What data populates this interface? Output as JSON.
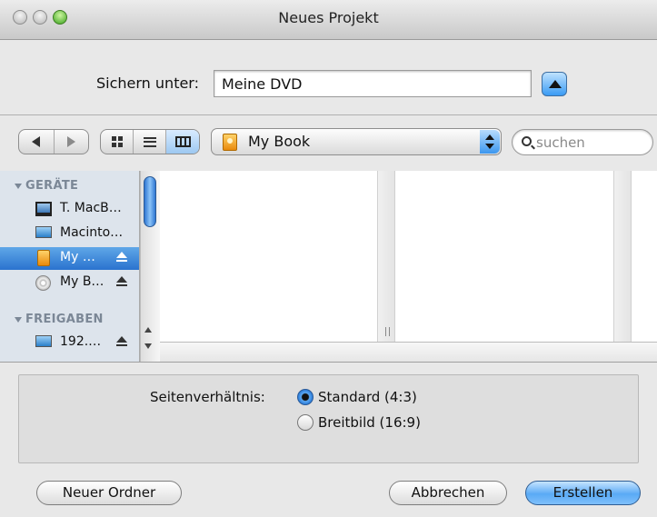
{
  "window": {
    "title": "Neues Projekt"
  },
  "save_as": {
    "label": "Sichern unter:",
    "value": "Meine DVD"
  },
  "toolbar": {
    "location": "My Book",
    "search_placeholder": "suchen"
  },
  "sidebar": {
    "sections": [
      {
        "header": "GERÄTE",
        "items": [
          {
            "label": "T. MacB…",
            "icon": "laptop-icon",
            "eject": false,
            "selected": false
          },
          {
            "label": "Macinto…",
            "icon": "hard-drive-icon",
            "eject": false,
            "selected": false
          },
          {
            "label": "My …",
            "icon": "external-drive-icon",
            "eject": true,
            "selected": true
          },
          {
            "label": "My B…",
            "icon": "disc-icon",
            "eject": true,
            "selected": false
          }
        ]
      },
      {
        "header": "FREIGABEN",
        "items": [
          {
            "label": "192.…",
            "icon": "network-computer-icon",
            "eject": true,
            "selected": false
          }
        ]
      }
    ]
  },
  "options": {
    "label": "Seitenverhältnis:",
    "choices": [
      {
        "label": "Standard (4:3)",
        "selected": true
      },
      {
        "label": "Breitbild (16:9)",
        "selected": false
      }
    ]
  },
  "buttons": {
    "new_folder": "Neuer Ordner",
    "cancel": "Abbrechen",
    "create": "Erstellen"
  },
  "colors": {
    "accent": "#3a8ef0",
    "sidebar_selection": "#2a73cf",
    "sidebar_bg": "#dde4ec"
  }
}
